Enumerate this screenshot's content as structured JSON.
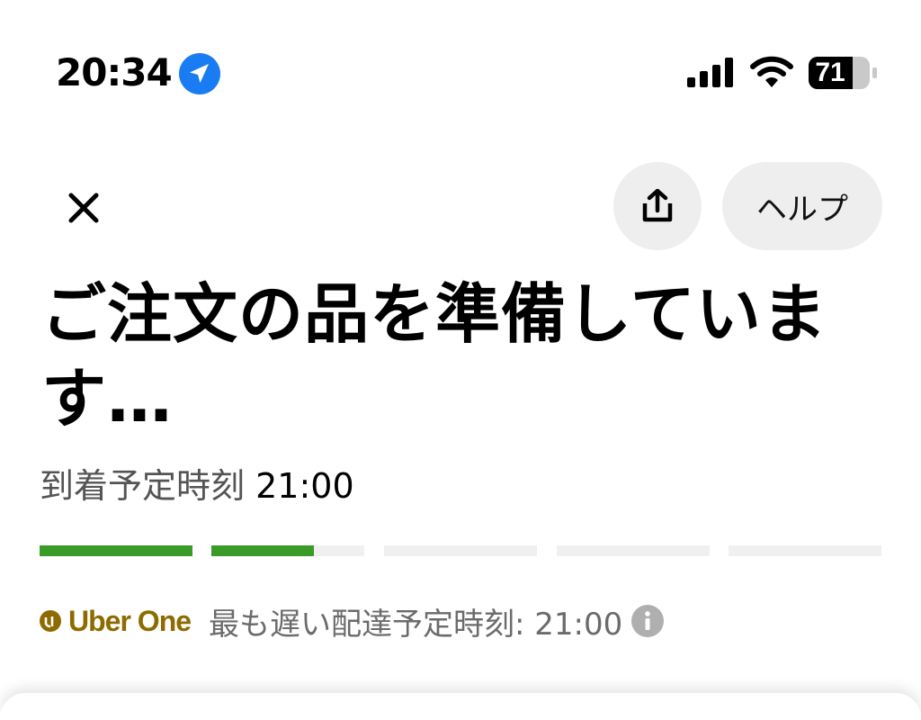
{
  "status_bar": {
    "time": "20:34",
    "battery_level": "71",
    "location_icon": "location-arrow-icon",
    "signal_icon": "cellular-signal-icon",
    "wifi_icon": "wifi-icon"
  },
  "header": {
    "close_icon": "close-icon",
    "share_icon": "share-icon",
    "help_label": "ヘルプ"
  },
  "order": {
    "title": "ご注文の品を準備しています…",
    "eta_label": "到着予定時刻",
    "eta_time": "21:00",
    "progress": {
      "segments": 5,
      "segment_fill": [
        1,
        0.67,
        0,
        0,
        0
      ],
      "active_color": "#3A9B28",
      "inactive_color": "#F0F0F0"
    }
  },
  "uber_one": {
    "brand": "Uber One",
    "brand_color": "#8D6B00",
    "latest_eta_text": "最も遅い配達予定時刻: 21:00",
    "info_icon": "info-icon"
  }
}
